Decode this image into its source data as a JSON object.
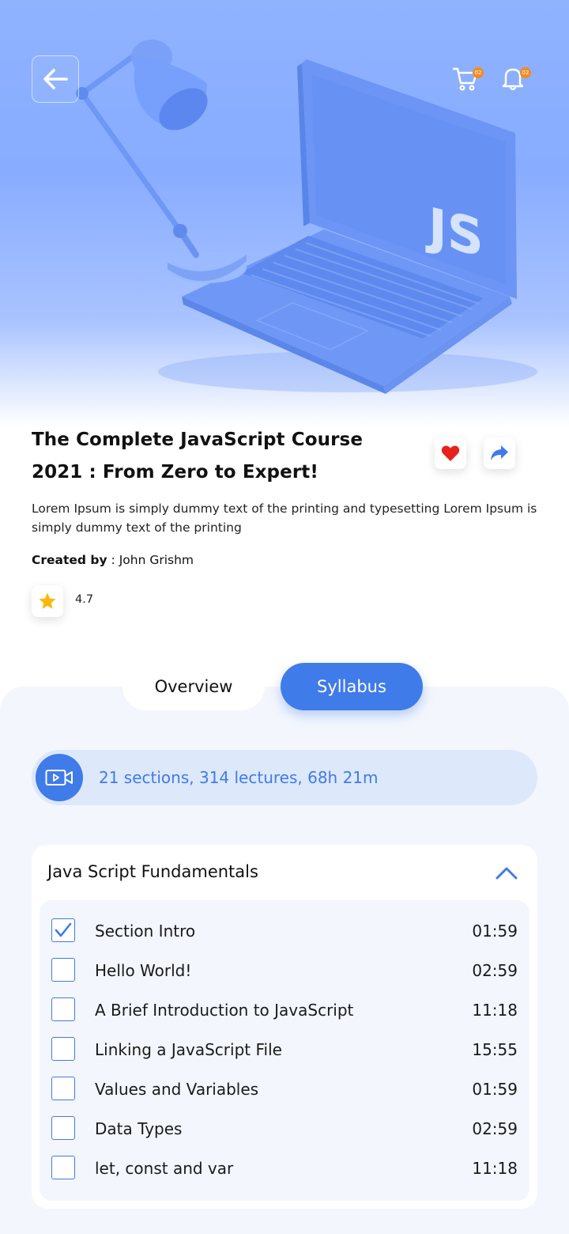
{
  "header": {
    "cart_badge": "02",
    "notification_badge": "02"
  },
  "hero": {
    "laptop_logo": "JS"
  },
  "course": {
    "title_line1": "The Complete JavaScript Course",
    "title_line2": "2021 : From Zero to Expert!",
    "description": "Lorem Ipsum is simply dummy text of the printing and typesetting Lorem Ipsum is simply dummy text of the printing",
    "created_by_label": "Created by",
    "created_by_sep": " : ",
    "author": "John Grishm",
    "rating": "4.7"
  },
  "tabs": [
    {
      "label": "Overview",
      "active": false
    },
    {
      "label": "Syllabus",
      "active": true
    }
  ],
  "summary": {
    "text": "21 sections, 314 lectures, 68h 21m"
  },
  "section": {
    "title": "Java Script Fundamentals",
    "expanded": true,
    "lessons": [
      {
        "title": "Section Intro",
        "duration": "01:59",
        "checked": true
      },
      {
        "title": "Hello World!",
        "duration": "02:59",
        "checked": false
      },
      {
        "title": "A Brief Introduction to JavaScript",
        "duration": "11:18",
        "checked": false
      },
      {
        "title": "Linking a JavaScript File",
        "duration": "15:55",
        "checked": false
      },
      {
        "title": "Values and Variables",
        "duration": "01:59",
        "checked": false
      },
      {
        "title": "Data Types",
        "duration": "02:59",
        "checked": false
      },
      {
        "title": "let, const and var",
        "duration": "11:18",
        "checked": false
      }
    ]
  },
  "colors": {
    "accent": "#3f7be9",
    "hero_blue": "#88acff",
    "panel_bg": "#f3f6fd",
    "badge_orange": "#f28b1f",
    "heart_red": "#e8211d",
    "star_yellow": "#f8b90c"
  },
  "icons": {
    "back": "arrow-left-icon",
    "cart": "cart-icon",
    "notification": "bell-icon",
    "favorite": "heart-icon",
    "share": "share-icon",
    "rating": "star-icon",
    "video": "video-icon",
    "collapse": "chevron-up-icon",
    "check": "check-icon"
  }
}
